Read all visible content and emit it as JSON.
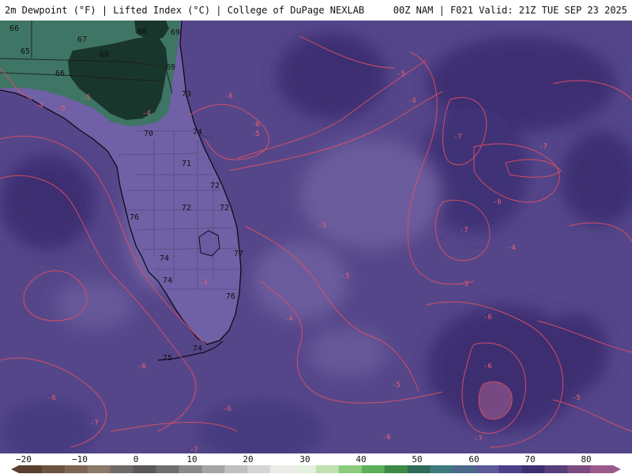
{
  "header": {
    "left_title": "2m Dewpoint (°F) | Lifted Index (°C) | College of DuPage NEXLAB",
    "right_title": "00Z NAM | F021 Valid: 21Z TUE SEP 23 2025"
  },
  "dewpoint_labels": [
    "66",
    "67",
    "68",
    "67",
    "65",
    "68",
    "69",
    "66",
    "69",
    "70",
    "73",
    "74",
    "71",
    "72",
    "72",
    "72",
    "76",
    "74",
    "74",
    "77",
    "76",
    "74",
    "75"
  ],
  "lifted_index_labels": [
    "-4",
    "-5",
    "-5",
    "-4",
    "-6",
    "-6",
    "-5",
    "-4",
    "-7",
    "-7",
    "-6",
    "-7",
    "-4",
    "-3",
    "-5",
    "-3",
    "-4",
    "-6",
    "-6",
    "-5",
    "-6",
    "-6",
    "-7",
    "-7",
    "-5",
    "-6",
    "-5",
    "-6",
    "-3",
    "-7"
  ],
  "colorbar": {
    "ticks": [
      "−20",
      "−10",
      "0",
      "10",
      "20",
      "30",
      "40",
      "50",
      "60",
      "70",
      "80"
    ],
    "colors": [
      "#5a3f2f",
      "#6e5240",
      "#7e6552",
      "#8a7868",
      "#6e6a68",
      "#5a5858",
      "#6e6e6e",
      "#8a8a8a",
      "#a4a4a4",
      "#c0c0c0",
      "#d6d6d6",
      "#ecece8",
      "#e6f0e0",
      "#bfe0b0",
      "#8ccc80",
      "#5cb05a",
      "#3c8a48",
      "#2f6a58",
      "#3f7a80",
      "#4a6a8c",
      "#5a5a9a",
      "#4b3f8a",
      "#3d2f70",
      "#553f7a",
      "#7a4a80",
      "#9a5a8c"
    ]
  }
}
